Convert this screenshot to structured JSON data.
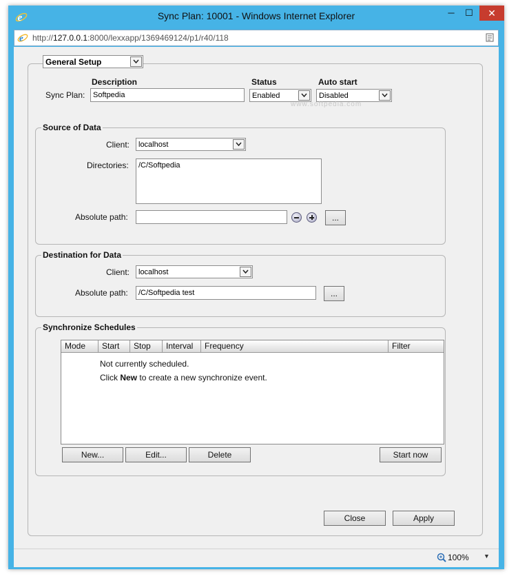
{
  "window": {
    "title": "Sync Plan: 10001 - Windows Internet Explorer",
    "minimize_glyph": "─",
    "maximize_glyph": "☐",
    "close_glyph": "✕"
  },
  "address_bar": {
    "url_prefix": "http://",
    "url_host": "127.0.0.1",
    "url_rest": ":8000/lexxapp/1369469124/p1/r40/118"
  },
  "page_select": {
    "value": "General Setup"
  },
  "plan": {
    "description_header": "Description",
    "status_header": "Status",
    "autostart_header": "Auto start",
    "sync_plan_label": "Sync Plan:",
    "description_value": "Softpedia",
    "status_value": "Enabled",
    "autostart_value": "Disabled"
  },
  "source": {
    "legend": "Source of Data",
    "client_label": "Client:",
    "client_value": "localhost",
    "directories_label": "Directories:",
    "directories_value": "/C/Softpedia",
    "abs_path_label": "Absolute path:",
    "abs_path_value": "",
    "browse_label": "..."
  },
  "destination": {
    "legend": "Destination for Data",
    "client_label": "Client:",
    "client_value": "localhost",
    "abs_path_label": "Absolute path:",
    "abs_path_value": "/C/Softpedia test",
    "browse_label": "..."
  },
  "schedules": {
    "legend": "Synchronize Schedules",
    "columns": [
      "Mode",
      "Start",
      "Stop",
      "Interval",
      "Frequency",
      "Filter"
    ],
    "empty_line1": "Not currently scheduled.",
    "empty_line2_pre": "Click ",
    "empty_line2_bold": "New",
    "empty_line2_post": " to create a new synchronize event.",
    "new_label": "New...",
    "edit_label": "Edit...",
    "delete_label": "Delete",
    "start_now_label": "Start now"
  },
  "footer": {
    "close_label": "Close",
    "apply_label": "Apply"
  },
  "statusbar": {
    "zoom": "100%"
  },
  "watermark": "www.softpedia.com",
  "colors": {
    "window_frame": "#46b3e6",
    "close_button": "#c73c2e",
    "content_bg": "#f0f0f0"
  }
}
